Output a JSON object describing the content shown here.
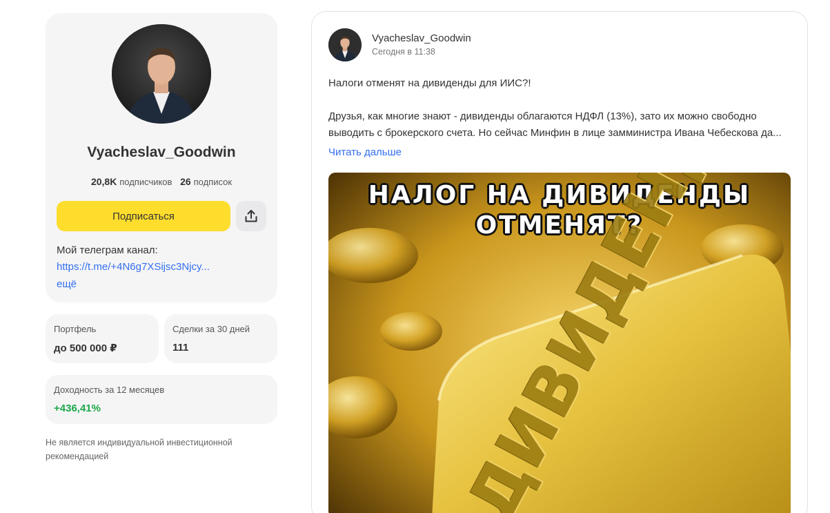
{
  "profile": {
    "name": "Vyacheslav_Goodwin",
    "subscribers_count": "20,8K",
    "subscribers_label": "подписчиков",
    "subscriptions_count": "26",
    "subscriptions_label": "подписок",
    "subscribe_label": "Подписаться",
    "share_icon": "share-icon",
    "bio_title": "Мой телеграм канал:",
    "bio_link": "https://t.me/+4N6g7XSijsc3Njcy...",
    "bio_more": "ещё"
  },
  "stats": {
    "portfolio": {
      "label": "Портфель",
      "value": "до 500 000 ₽"
    },
    "deals": {
      "label": "Сделки за 30 дней",
      "value": "111"
    },
    "yield": {
      "label": "Доходность за 12 месяцев",
      "value": "+436,41%"
    }
  },
  "disclaimer": "Не является индивидуальной инвестиционной рекомендацией",
  "post": {
    "author": "Vyacheslav_Goodwin",
    "time": "Сегодня в 11:38",
    "text_line1": "Налоги отменят на дивиденды для ИИС?!",
    "text_line2": "Друзья, как многие знают - дивиденды облагаются НДФЛ (13%), зато их можно свободно",
    "text_line3": "выводить с брокерского счета.  Но сейчас Минфин в лице замминистра Ивана Чебескова да...",
    "read_more": "Читать дальше",
    "image": {
      "headline_line1": "НАЛОГ НА ДИВИДЕНДЫ",
      "headline_line2": "ОТМЕНЯТ?",
      "bar_word": "ДИВИДЕНДЫ"
    }
  },
  "colors": {
    "accent_yellow": "#ffdd2d",
    "link_blue": "#336fee",
    "positive_green": "#1ca84a",
    "card_bg": "#f5f5f6"
  }
}
